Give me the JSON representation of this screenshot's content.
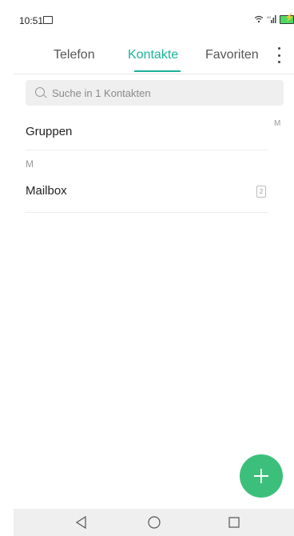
{
  "status_bar": {
    "time": "10:51"
  },
  "tabs": [
    {
      "label": "Telefon",
      "active": false
    },
    {
      "label": "Kontakte",
      "active": true
    },
    {
      "label": "Favoriten",
      "active": false
    }
  ],
  "search": {
    "placeholder": "Suche in 1 Kontakten"
  },
  "list": {
    "groups_label": "Gruppen",
    "section_letter": "M",
    "contacts": [
      {
        "name": "Mailbox",
        "sim": "2"
      }
    ]
  },
  "index_bar": {
    "letters": [
      "M"
    ]
  },
  "colors": {
    "accent": "#19b39a",
    "fab": "#3cbf7a",
    "battery": "#4cd964"
  }
}
